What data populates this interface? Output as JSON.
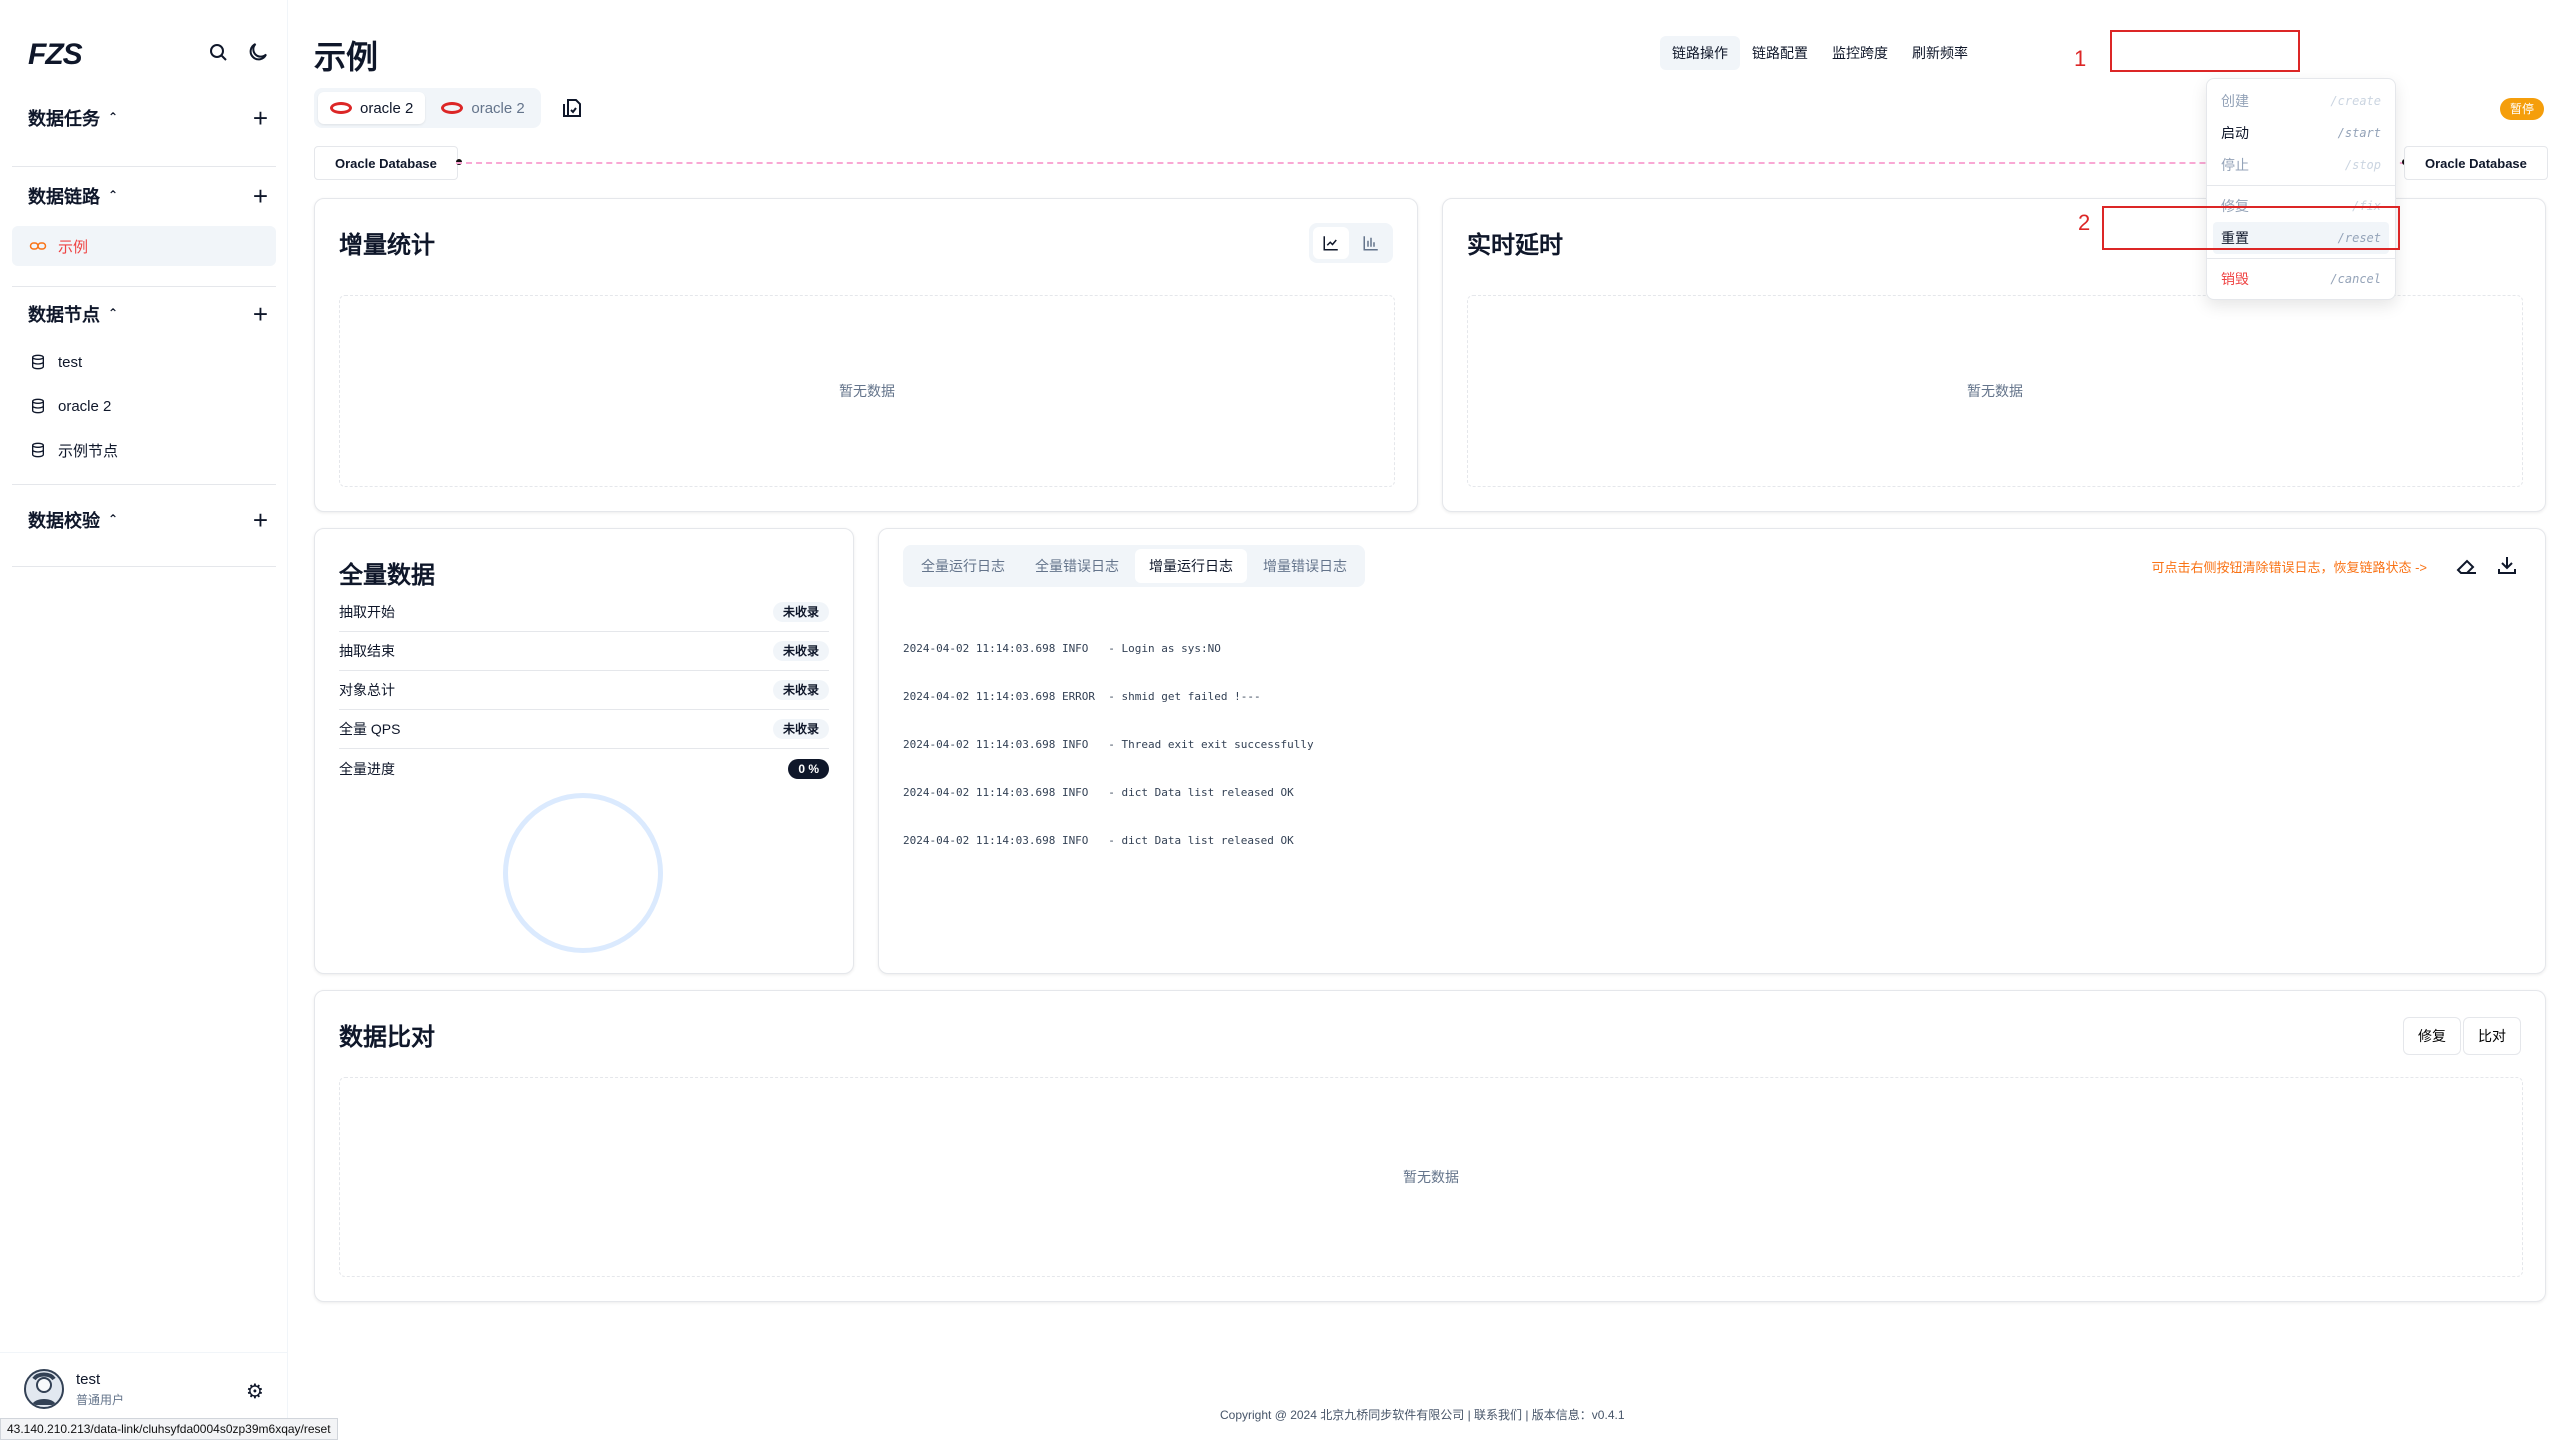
{
  "app": {
    "logo": "FZS",
    "page_title": "示例"
  },
  "sidebar": {
    "sections": [
      {
        "label": "数据任务",
        "items": []
      },
      {
        "label": "数据链路",
        "items": [
          {
            "label": "示例",
            "active": true
          }
        ]
      },
      {
        "label": "数据节点",
        "items": [
          {
            "label": "test"
          },
          {
            "label": "oracle 2"
          },
          {
            "label": "示例节点"
          }
        ]
      },
      {
        "label": "数据校验",
        "items": []
      }
    ],
    "user": {
      "name": "test",
      "role": "普通用户"
    }
  },
  "status_url": "43.140.210.213/data-link/cluhsyfda0004s0zp39m6xqay/reset",
  "header": {
    "tabs": [
      "链路操作",
      "链路配置",
      "监控跨度",
      "刷新频率"
    ],
    "active_tab": 0
  },
  "nodes": {
    "tabs": [
      "oracle 2",
      "oracle 2"
    ],
    "source_db": "Oracle Database",
    "target_db": "Oracle Database",
    "status_badge": "暂停"
  },
  "dropdown": {
    "items": [
      {
        "label": "创建",
        "shortcut": "/create",
        "state": "disabled"
      },
      {
        "label": "启动",
        "shortcut": "/start",
        "state": "normal"
      },
      {
        "label": "停止",
        "shortcut": "/stop",
        "state": "disabled"
      },
      {
        "label": "修复",
        "shortcut": "/fix",
        "state": "disabled"
      },
      {
        "label": "重置",
        "shortcut": "/reset",
        "state": "highlighted"
      },
      {
        "label": "销毁",
        "shortcut": "/cancel",
        "state": "danger"
      }
    ]
  },
  "incremental": {
    "title": "增量统计",
    "empty": "暂无数据",
    "chart_modes": [
      "line-chart-icon",
      "bar-chart-icon"
    ]
  },
  "latency": {
    "title": "实时延时",
    "empty": "暂无数据"
  },
  "full_data": {
    "title": "全量数据",
    "rows": [
      {
        "label": "抽取开始",
        "value": "未收录"
      },
      {
        "label": "抽取结束",
        "value": "未收录"
      },
      {
        "label": "对象总计",
        "value": "未收录"
      },
      {
        "label": "全量 QPS",
        "value": "未收录"
      },
      {
        "label": "全量进度",
        "value": "0 %"
      }
    ]
  },
  "logs": {
    "tabs": [
      "全量运行日志",
      "全量错误日志",
      "增量运行日志",
      "增量错误日志"
    ],
    "active_tab": 2,
    "hint": "可点击右侧按钮清除错误日志，恢复链路状态 ->",
    "lines": [
      "2024-04-02 11:14:03.698 INFO   - Login as sys:NO",
      "2024-04-02 11:14:03.698 ERROR  - shmid get failed !---",
      "2024-04-02 11:14:03.698 INFO   - Thread exit exit successfully",
      "2024-04-02 11:14:03.698 INFO   - dict Data list released OK",
      "2024-04-02 11:14:03.698 INFO   - dict Data list released OK"
    ]
  },
  "compare": {
    "title": "数据比对",
    "fix_label": "修复",
    "compare_label": "比对",
    "empty": "暂无数据"
  },
  "footer": "Copyright @ 2024 北京九桥同步软件有限公司 | 联系我们 | 版本信息：v0.4.1",
  "annotations": [
    "1",
    "2"
  ],
  "colors": {
    "accent": "#ef4444",
    "warning": "#f59e0b",
    "annotation": "#dc2626",
    "oracle": "#dc2626"
  }
}
